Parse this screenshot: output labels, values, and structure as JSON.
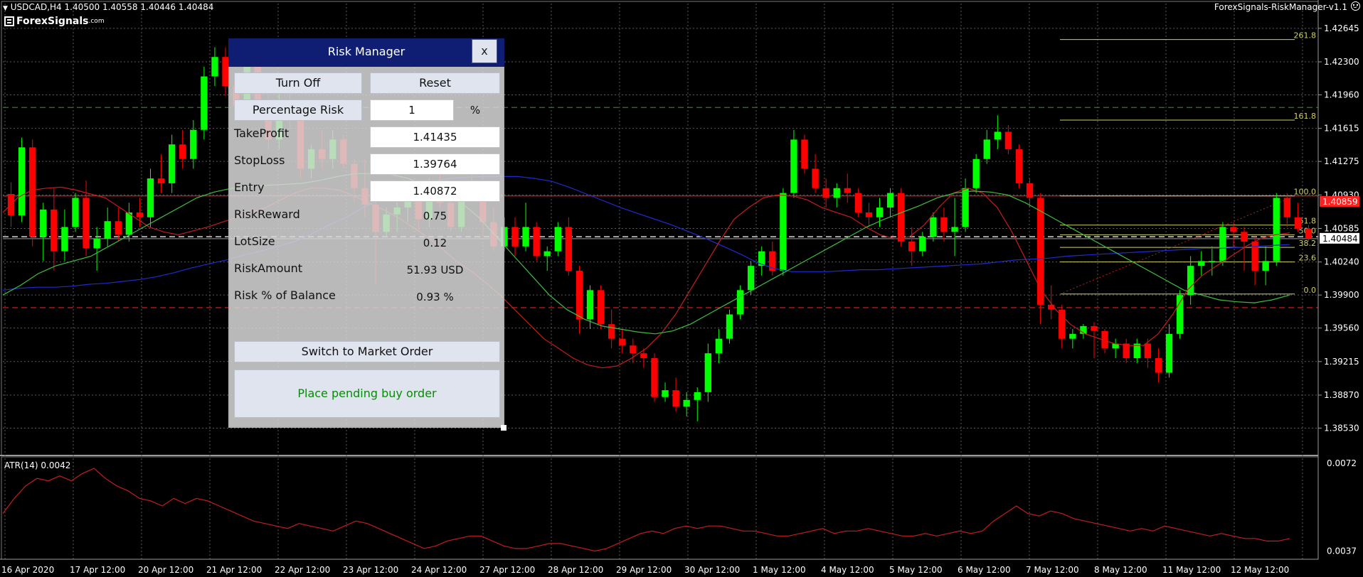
{
  "header": {
    "symbol_info": "USDCAD,H4  1.40500 1.40558 1.40446 1.40484",
    "indicator_name": "ForexSignals-RiskManager-v1.1",
    "logo_text": "ForexSignals",
    "logo_suffix": ".com",
    "menu_icon": "triangle-down-icon"
  },
  "colors": {
    "bull": "#00ff00",
    "bear": "#ff0000",
    "fib": "#cfcf6a",
    "ma_slow": "#1f2bcf",
    "ma_mid": "#c41d1d",
    "ma_fast": "#3fbf3f",
    "current_price_tag": "#ff2020"
  },
  "chart_data": {
    "type": "candlestick",
    "symbol": "USDCAD",
    "timeframe": "H4",
    "ylim": [
      1.3827,
      1.429
    ],
    "price_ticks": [
      "1.42645",
      "1.42300",
      "1.41960",
      "1.41615",
      "1.41275",
      "1.40930",
      "1.40585",
      "1.40240",
      "1.39900",
      "1.39560",
      "1.39215",
      "1.38870",
      "1.38530"
    ],
    "time_labels": [
      "16 Apr 2020",
      "17 Apr 12:00",
      "20 Apr 12:00",
      "21 Apr 12:00",
      "22 Apr 12:00",
      "23 Apr 12:00",
      "24 Apr 12:00",
      "27 Apr 12:00",
      "28 Apr 12:00",
      "29 Apr 12:00",
      "30 Apr 12:00",
      "1 May 12:00",
      "4 May 12:00",
      "5 May 12:00",
      "6 May 12:00",
      "7 May 12:00",
      "8 May 12:00",
      "11 May 12:00",
      "12 May 12:00"
    ],
    "candles": [
      [
        1.4094,
        1.4106,
        1.406,
        1.4072
      ],
      [
        1.4072,
        1.4152,
        1.4065,
        1.4142
      ],
      [
        1.4142,
        1.415,
        1.404,
        1.405
      ],
      [
        1.405,
        1.4085,
        1.4025,
        1.4078
      ],
      [
        1.4078,
        1.41,
        1.4015,
        1.4035
      ],
      [
        1.4035,
        1.4078,
        1.4025,
        1.406
      ],
      [
        1.406,
        1.4095,
        1.4055,
        1.409
      ],
      [
        1.409,
        1.4108,
        1.403,
        1.4038
      ],
      [
        1.4038,
        1.406,
        1.4015,
        1.4048
      ],
      [
        1.4048,
        1.408,
        1.404,
        1.4066
      ],
      [
        1.4066,
        1.408,
        1.4045,
        1.4052
      ],
      [
        1.4052,
        1.4085,
        1.4045,
        1.4075
      ],
      [
        1.4075,
        1.409,
        1.406,
        1.407
      ],
      [
        1.407,
        1.412,
        1.406,
        1.411
      ],
      [
        1.411,
        1.4135,
        1.4095,
        1.4105
      ],
      [
        1.4105,
        1.4155,
        1.4095,
        1.4145
      ],
      [
        1.4145,
        1.416,
        1.412,
        1.413
      ],
      [
        1.413,
        1.417,
        1.412,
        1.416
      ],
      [
        1.416,
        1.4225,
        1.415,
        1.4215
      ],
      [
        1.4215,
        1.4245,
        1.4205,
        1.4235
      ],
      [
        1.4235,
        1.4245,
        1.4195,
        1.4205
      ],
      [
        1.4205,
        1.4215,
        1.4175,
        1.4185
      ],
      [
        1.4185,
        1.4235,
        1.4175,
        1.4225
      ],
      [
        1.4225,
        1.4235,
        1.417,
        1.418
      ],
      [
        1.418,
        1.42,
        1.414,
        1.415
      ],
      [
        1.415,
        1.42,
        1.414,
        1.419
      ],
      [
        1.419,
        1.4205,
        1.416,
        1.417
      ],
      [
        1.417,
        1.419,
        1.411,
        1.412
      ],
      [
        1.412,
        1.4145,
        1.411,
        1.414
      ],
      [
        1.414,
        1.416,
        1.412,
        1.413
      ],
      [
        1.413,
        1.416,
        1.412,
        1.415
      ],
      [
        1.415,
        1.4155,
        1.412,
        1.4125
      ],
      [
        1.4125,
        1.413,
        1.4085,
        1.41
      ],
      [
        1.41,
        1.413,
        1.407,
        1.4083
      ],
      [
        1.4083,
        1.4092,
        1.4,
        1.4055
      ],
      [
        1.4055,
        1.408,
        1.405,
        1.4073
      ],
      [
        1.4073,
        1.4085,
        1.4055,
        1.408
      ],
      [
        1.408,
        1.41,
        1.4065,
        1.409
      ],
      [
        1.409,
        1.41,
        1.4055,
        1.4068
      ],
      [
        1.4068,
        1.411,
        1.406,
        1.41
      ],
      [
        1.41,
        1.412,
        1.408,
        1.4085
      ],
      [
        1.4085,
        1.4105,
        1.4055,
        1.406
      ],
      [
        1.406,
        1.4105,
        1.4055,
        1.41
      ],
      [
        1.41,
        1.412,
        1.4085,
        1.409
      ],
      [
        1.409,
        1.41,
        1.405,
        1.4065
      ],
      [
        1.4065,
        1.408,
        1.4035,
        1.404
      ],
      [
        1.404,
        1.407,
        1.4035,
        1.406
      ],
      [
        1.406,
        1.407,
        1.403,
        1.404
      ],
      [
        1.404,
        1.4085,
        1.4035,
        1.406
      ],
      [
        1.406,
        1.4065,
        1.4025,
        1.403
      ],
      [
        1.403,
        1.404,
        1.4015,
        1.4035
      ],
      [
        1.4035,
        1.4065,
        1.403,
        1.406
      ],
      [
        1.406,
        1.407,
        1.401,
        1.4015
      ],
      [
        1.4015,
        1.402,
        1.395,
        1.3965
      ],
      [
        1.3965,
        1.4,
        1.3955,
        1.3995
      ],
      [
        1.3995,
        1.4,
        1.3955,
        1.396
      ],
      [
        1.396,
        1.3975,
        1.3935,
        1.3945
      ],
      [
        1.3945,
        1.3955,
        1.393,
        1.3938
      ],
      [
        1.3938,
        1.3945,
        1.392,
        1.393
      ],
      [
        1.393,
        1.3935,
        1.3915,
        1.3925
      ],
      [
        1.3925,
        1.393,
        1.388,
        1.3885
      ],
      [
        1.3885,
        1.39,
        1.388,
        1.3892
      ],
      [
        1.3892,
        1.3905,
        1.387,
        1.3875
      ],
      [
        1.3875,
        1.389,
        1.3865,
        1.3882
      ],
      [
        1.3882,
        1.3895,
        1.386,
        1.389
      ],
      [
        1.389,
        1.394,
        1.388,
        1.393
      ],
      [
        1.393,
        1.3955,
        1.392,
        1.3945
      ],
      [
        1.3945,
        1.3975,
        1.394,
        1.397
      ],
      [
        1.397,
        1.4,
        1.3965,
        1.3995
      ],
      [
        1.3995,
        1.4025,
        1.399,
        1.402
      ],
      [
        1.402,
        1.404,
        1.401,
        1.4035
      ],
      [
        1.4035,
        1.4045,
        1.401,
        1.4015
      ],
      [
        1.4015,
        1.41,
        1.401,
        1.4095
      ],
      [
        1.4095,
        1.416,
        1.409,
        1.415
      ],
      [
        1.415,
        1.4155,
        1.4115,
        1.412
      ],
      [
        1.412,
        1.4135,
        1.4095,
        1.41
      ],
      [
        1.41,
        1.411,
        1.408,
        1.409
      ],
      [
        1.409,
        1.4105,
        1.408,
        1.41
      ],
      [
        1.41,
        1.4115,
        1.4085,
        1.4095
      ],
      [
        1.4095,
        1.41,
        1.407,
        1.4075
      ],
      [
        1.4075,
        1.4085,
        1.406,
        1.407
      ],
      [
        1.407,
        1.409,
        1.406,
        1.408
      ],
      [
        1.408,
        1.41,
        1.407,
        1.4095
      ],
      [
        1.4095,
        1.41,
        1.404,
        1.4045
      ],
      [
        1.4045,
        1.406,
        1.402,
        1.4035
      ],
      [
        1.4035,
        1.4055,
        1.403,
        1.405
      ],
      [
        1.405,
        1.4075,
        1.4045,
        1.407
      ],
      [
        1.407,
        1.408,
        1.4045,
        1.4055
      ],
      [
        1.4055,
        1.409,
        1.403,
        1.406
      ],
      [
        1.406,
        1.411,
        1.4055,
        1.41
      ],
      [
        1.41,
        1.4135,
        1.4095,
        1.413
      ],
      [
        1.413,
        1.416,
        1.4125,
        1.415
      ],
      [
        1.415,
        1.4175,
        1.414,
        1.4158
      ],
      [
        1.4158,
        1.4165,
        1.4135,
        1.414
      ],
      [
        1.414,
        1.4145,
        1.41,
        1.4105
      ],
      [
        1.4105,
        1.411,
        1.408,
        1.409
      ],
      [
        1.409,
        1.4095,
        1.396,
        1.398
      ],
      [
        1.398,
        1.4,
        1.3965,
        1.3975
      ],
      [
        1.3975,
        1.398,
        1.3935,
        1.3945
      ],
      [
        1.3945,
        1.3955,
        1.3935,
        1.395
      ],
      [
        1.395,
        1.396,
        1.3945,
        1.3958
      ],
      [
        1.3958,
        1.3962,
        1.3925,
        1.3953
      ],
      [
        1.3953,
        1.3955,
        1.393,
        1.3935
      ],
      [
        1.3935,
        1.3945,
        1.3925,
        1.394
      ],
      [
        1.394,
        1.3945,
        1.392,
        1.3925
      ],
      [
        1.3925,
        1.3945,
        1.392,
        1.394
      ],
      [
        1.394,
        1.3945,
        1.3915,
        1.3925
      ],
      [
        1.3925,
        1.3935,
        1.39,
        1.391
      ],
      [
        1.391,
        1.396,
        1.3905,
        1.395
      ],
      [
        1.395,
        1.3995,
        1.3945,
        1.399
      ],
      [
        1.399,
        1.403,
        1.398,
        1.402
      ],
      [
        1.402,
        1.4035,
        1.401,
        1.4025
      ],
      [
        1.4025,
        1.404,
        1.401,
        1.4025
      ],
      [
        1.4025,
        1.4065,
        1.402,
        1.406
      ],
      [
        1.406,
        1.4065,
        1.404,
        1.4055
      ],
      [
        1.4055,
        1.406,
        1.4015,
        1.4045
      ],
      [
        1.4045,
        1.405,
        1.4,
        1.4015
      ],
      [
        1.4015,
        1.404,
        1.4,
        1.4025
      ],
      [
        1.4025,
        1.4095,
        1.402,
        1.409
      ],
      [
        1.409,
        1.4095,
        1.406,
        1.407
      ],
      [
        1.407,
        1.4085,
        1.4055,
        1.4058
      ],
      [
        1.4058,
        1.4062,
        1.4045,
        1.4048
      ]
    ],
    "moving_averages": [
      {
        "key": "ma_slow",
        "values": [
          1.3995,
          1.3997,
          1.3998,
          1.3998,
          1.3999,
          1.4001,
          1.4002,
          1.4004,
          1.4006,
          1.4009,
          1.4013,
          1.4018,
          1.4022,
          1.4026,
          1.4031,
          1.4035,
          1.404,
          1.4045,
          1.4053,
          1.4062,
          1.407,
          1.408,
          1.4089,
          1.4097,
          1.4103,
          1.4107,
          1.411,
          1.4111,
          1.4112,
          1.4112,
          1.4112,
          1.411,
          1.4107,
          1.4101,
          1.4094,
          1.4087,
          1.408,
          1.4074,
          1.4068,
          1.4062,
          1.4055,
          1.4048,
          1.404,
          1.4032,
          1.4023,
          1.4017,
          1.4014,
          1.4014,
          1.4014,
          1.4015,
          1.4016,
          1.4016,
          1.4017,
          1.4018,
          1.4019,
          1.402,
          1.4021,
          1.4022,
          1.4024,
          1.4026,
          1.4027,
          1.4028,
          1.403,
          1.4031,
          1.4032,
          1.4033,
          1.4034,
          1.4035,
          1.4036,
          1.4037,
          1.4038,
          1.4038,
          1.4039,
          1.404,
          1.4041,
          1.4042
        ]
      },
      {
        "key": "ma_mid",
        "values": [
          1.4075,
          1.409,
          1.4098,
          1.41,
          1.4101,
          1.4098,
          1.4094,
          1.409,
          1.408,
          1.407,
          1.406,
          1.4055,
          1.4052,
          1.4056,
          1.406,
          1.4065,
          1.407,
          1.4075,
          1.408,
          1.4088,
          1.4095,
          1.41,
          1.41,
          1.4098,
          1.4092,
          1.4085,
          1.4078,
          1.407,
          1.406,
          1.405,
          1.4038,
          1.4025,
          1.4015,
          1.4003,
          1.399,
          1.3975,
          1.396,
          1.3945,
          1.3935,
          1.3925,
          1.3918,
          1.3915,
          1.3917,
          1.3925,
          1.3935,
          1.395,
          1.397,
          1.3995,
          1.402,
          1.4045,
          1.4068,
          1.408,
          1.409,
          1.4093,
          1.4092,
          1.4088,
          1.408,
          1.4075,
          1.407,
          1.406,
          1.4052,
          1.4048,
          1.405,
          1.4062,
          1.408,
          1.4095,
          1.41,
          1.4095,
          1.408,
          1.4055,
          1.4025,
          1.3995,
          1.3975,
          1.396,
          1.395,
          1.3945,
          1.394,
          1.3938,
          1.3938,
          1.395,
          1.397,
          1.3995,
          1.401,
          1.402,
          1.403,
          1.404,
          1.4048,
          1.4052,
          1.4054
        ]
      },
      {
        "key": "ma_fast",
        "values": [
          1.399,
          1.4,
          1.4012,
          1.402,
          1.4025,
          1.403,
          1.404,
          1.405,
          1.406,
          1.407,
          1.408,
          1.409,
          1.4096,
          1.41,
          1.4102,
          1.4103,
          1.4104,
          1.4105,
          1.4108,
          1.4112,
          1.4115,
          1.4115,
          1.4114,
          1.411,
          1.4103,
          1.4095,
          1.4085,
          1.407,
          1.405,
          1.403,
          1.401,
          1.399,
          1.3975,
          1.3965,
          1.3958,
          1.3955,
          1.3952,
          1.395,
          1.3953,
          1.396,
          1.397,
          1.398,
          1.399,
          1.4,
          1.401,
          1.402,
          1.403,
          1.404,
          1.405,
          1.406,
          1.4068,
          1.4075,
          1.4082,
          1.409,
          1.4095,
          1.4097,
          1.4096,
          1.4093,
          1.4085,
          1.4075,
          1.4065,
          1.4055,
          1.4045,
          1.4035,
          1.4025,
          1.4015,
          1.4005,
          1.3995,
          1.399,
          1.3985,
          1.3983,
          1.3982,
          1.3985,
          1.399
        ]
      }
    ],
    "horizontal_lines": [
      {
        "price": 1.4183,
        "color": "#2f7a2f",
        "style": "dashed"
      },
      {
        "price": 1.4092,
        "color": "#b51c1c",
        "style": "solid"
      },
      {
        "price": 1.405,
        "color": "#ffffff",
        "style": "dashed"
      },
      {
        "price": 1.4048,
        "color": "#7d7d7d",
        "style": "solid"
      },
      {
        "price": 1.3977,
        "color": "#b51c1c",
        "style": "dashed"
      }
    ],
    "fib_levels": [
      {
        "label": "261.8",
        "price": 1.4253
      },
      {
        "label": "161.8",
        "price": 1.417
      },
      {
        "label": "100.0",
        "price": 1.4092
      },
      {
        "label": "61.8",
        "price": 1.4062
      },
      {
        "label": "50.0",
        "price": 1.4052
      },
      {
        "label": "38.2",
        "price": 1.4039
      },
      {
        "label": "23.6",
        "price": 1.4024
      },
      {
        "label": "0.0",
        "price": 1.3991
      }
    ],
    "price_tags": [
      {
        "text": "1.40859",
        "price": 1.4086,
        "bg": "#ff2020",
        "fg": "#ffffff"
      },
      {
        "text": "1.40484",
        "price": 1.4048,
        "bg": "#ffffff",
        "fg": "#000000"
      }
    ],
    "atr": {
      "label": "ATR(14) 0.0042",
      "ticks": [
        "0.0072",
        "0.0037"
      ],
      "ylim": [
        0.0036,
        0.0074
      ],
      "values": [
        0.0052,
        0.0058,
        0.0063,
        0.0066,
        0.0065,
        0.0067,
        0.0065,
        0.0068,
        0.007,
        0.0066,
        0.0063,
        0.0061,
        0.0058,
        0.0057,
        0.0055,
        0.0058,
        0.0056,
        0.0058,
        0.0057,
        0.0055,
        0.0053,
        0.0051,
        0.0049,
        0.0048,
        0.0047,
        0.0046,
        0.0048,
        0.0047,
        0.0046,
        0.0045,
        0.0047,
        0.0049,
        0.0048,
        0.0046,
        0.0044,
        0.0042,
        0.004,
        0.0038,
        0.0039,
        0.0041,
        0.0042,
        0.0043,
        0.0043,
        0.0041,
        0.0039,
        0.0038,
        0.0038,
        0.0039,
        0.004,
        0.004,
        0.0039,
        0.0038,
        0.0037,
        0.0038,
        0.004,
        0.0042,
        0.0044,
        0.0045,
        0.0044,
        0.0046,
        0.0047,
        0.0046,
        0.0047,
        0.0047,
        0.0046,
        0.0045,
        0.0045,
        0.0044,
        0.0043,
        0.0043,
        0.0044,
        0.0045,
        0.0046,
        0.0044,
        0.0045,
        0.0045,
        0.0046,
        0.0045,
        0.0044,
        0.0043,
        0.0043,
        0.0044,
        0.0043,
        0.0044,
        0.0045,
        0.0044,
        0.0045,
        0.0049,
        0.0052,
        0.0055,
        0.0052,
        0.0051,
        0.0053,
        0.0052,
        0.005,
        0.0049,
        0.0048,
        0.0047,
        0.0046,
        0.0045,
        0.0046,
        0.0045,
        0.0047,
        0.0046,
        0.0045,
        0.0044,
        0.0043,
        0.0044,
        0.0043,
        0.0042,
        0.0042,
        0.0041,
        0.0041,
        0.0042
      ]
    }
  },
  "risk_manager": {
    "title": "Risk Manager",
    "close_label": "x",
    "turn_off_label": "Turn Off",
    "reset_label": "Reset",
    "percentage_risk_label": "Percentage Risk",
    "percentage_value": "1",
    "percent_unit": "%",
    "take_profit_label": "TakeProfit",
    "take_profit_value": "1.41435",
    "stop_loss_label": "StopLoss",
    "stop_loss_value": "1.39764",
    "entry_label": "Entry",
    "entry_value": "1.40872",
    "risk_reward_label": "RiskReward",
    "risk_reward_value": "0.75",
    "lot_size_label": "LotSize",
    "lot_size_value": "0.12",
    "risk_amount_label": "RiskAmount",
    "risk_amount_value": "51.93 USD",
    "risk_pct_balance_label": "Risk % of Balance",
    "risk_pct_balance_value": "0.93 %",
    "switch_order_label": "Switch to Market Order",
    "place_order_label": "Place pending buy order"
  }
}
